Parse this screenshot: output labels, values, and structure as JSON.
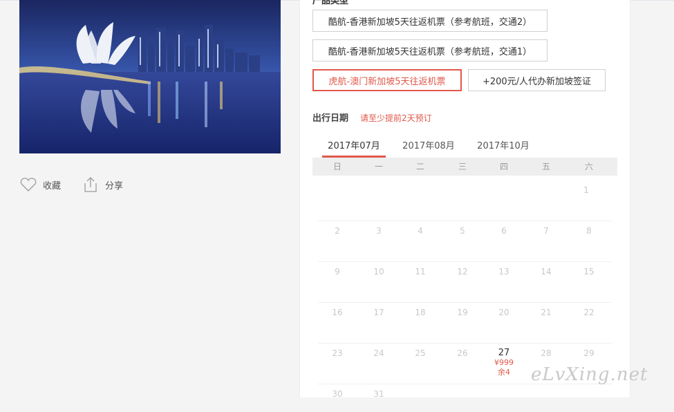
{
  "left": {
    "actions": {
      "favorite_label": "收藏",
      "share_label": "分享"
    }
  },
  "panel": {
    "section_title": "产品类型",
    "options": [
      {
        "label": "酷航-香港新加坡5天往返机票（参考航班，交通2）",
        "selected": false
      },
      {
        "label": "酷航-香港新加坡5天往返机票（参考航班，交通1）",
        "selected": false
      },
      {
        "label": "虎航-澳门新加坡5天往返机票",
        "selected": true
      },
      {
        "label": "+200元/人代办新加坡签证",
        "selected": false
      }
    ],
    "date_title": "出行日期",
    "date_hint": "请至少提前2天预订",
    "months": [
      "2017年07月",
      "2017年08月",
      "2017年10月"
    ],
    "weekdays": [
      "日",
      "一",
      "二",
      "三",
      "四",
      "五",
      "六"
    ],
    "calendar": [
      [
        "",
        "",
        "",
        "",
        "",
        "",
        "1"
      ],
      [
        "2",
        "3",
        "4",
        "5",
        "6",
        "7",
        "8"
      ],
      [
        "9",
        "10",
        "11",
        "12",
        "13",
        "14",
        "15"
      ],
      [
        "16",
        "17",
        "18",
        "19",
        "20",
        "21",
        "22"
      ],
      [
        "23",
        "24",
        "25",
        "26",
        "27",
        "28",
        "29"
      ],
      [
        "30",
        "31",
        "",
        "",
        "",
        "",
        ""
      ]
    ],
    "available": [
      {
        "day": "27",
        "price": "¥999",
        "stock": "余4"
      }
    ]
  },
  "watermark": "eLvXing.net",
  "colors": {
    "accent": "#e1584a"
  }
}
